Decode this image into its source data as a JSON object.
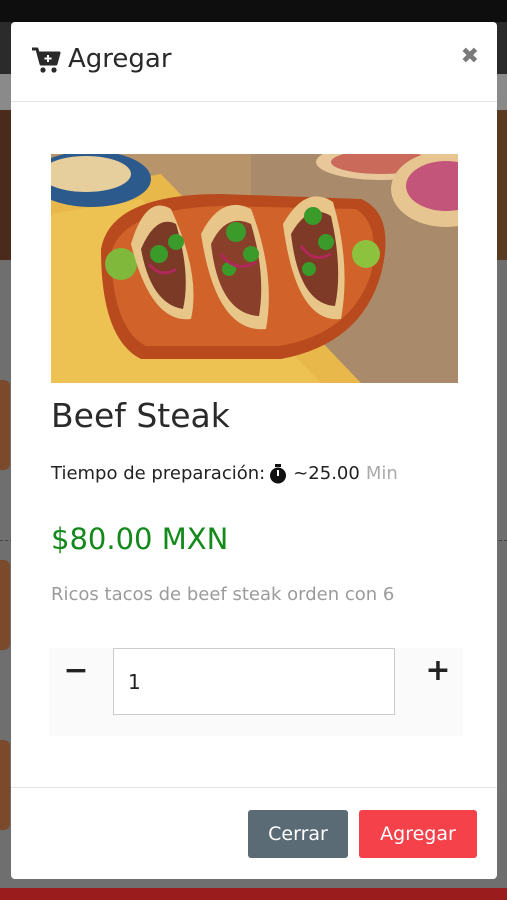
{
  "modal": {
    "title": "Agregar",
    "close_symbol": "✖"
  },
  "product": {
    "name": "Beef Steak",
    "prep_label": "Tiempo de preparación:",
    "prep_time": "~25.00",
    "prep_unit": "Min",
    "price": "$80.00 MXN",
    "description": "Ricos tacos de beef steak orden con 6"
  },
  "quantity": {
    "minus_label": "−",
    "plus_label": "+",
    "value": "1"
  },
  "footer": {
    "close_label": "Cerrar",
    "add_label": "Agregar"
  },
  "colors": {
    "price": "#12891a",
    "close_button": "#5a6b75",
    "add_button": "#f4414a"
  },
  "icons": {
    "header": "cart-plus-icon",
    "timer": "stopwatch-icon",
    "close": "close-icon"
  }
}
